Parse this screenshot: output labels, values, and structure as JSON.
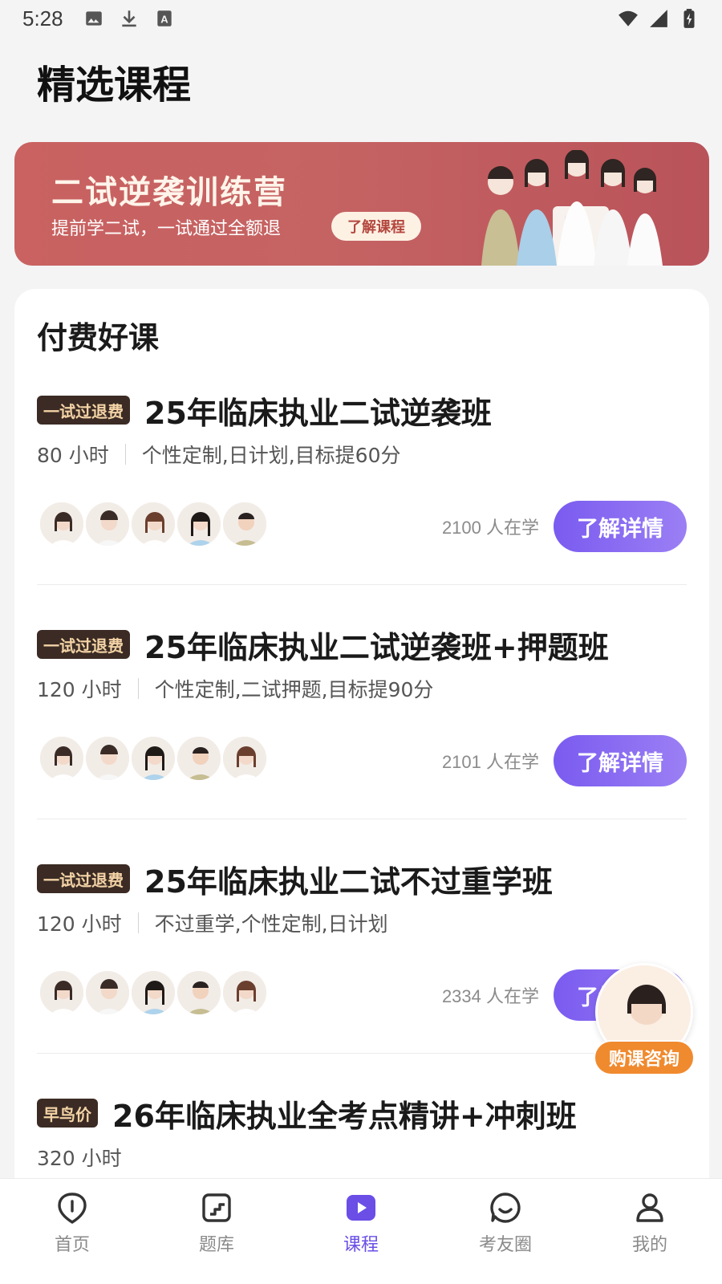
{
  "status_bar": {
    "time": "5:28",
    "left_icons": [
      "image-icon",
      "download-icon",
      "a-icon"
    ],
    "right_icons": [
      "wifi-icon",
      "signal-icon",
      "battery-icon"
    ]
  },
  "page_title": "精选课程",
  "banner": {
    "title": "二试逆袭训练营",
    "subtitle": "提前学二试，一试通过全额退",
    "button_label": "了解课程"
  },
  "section": {
    "title": "付费好课"
  },
  "courses": [
    {
      "badge": "一试过退费",
      "title": "25年临床执业二试逆袭班",
      "hours": "80 小时",
      "features": "个性定制,日计划,目标提60分",
      "learners": "2100 人在学",
      "button_label": "了解详情"
    },
    {
      "badge": "一试过退费",
      "title": "25年临床执业二试逆袭班+押题班",
      "hours": "120 小时",
      "features": "个性定制,二试押题,目标提90分",
      "learners": "2101 人在学",
      "button_label": "了解详情"
    },
    {
      "badge": "一试过退费",
      "title": "25年临床执业二试不过重学班",
      "hours": "120 小时",
      "features": "不过重学,个性定制,日计划",
      "learners": "2334 人在学",
      "button_label": "了解详情"
    },
    {
      "badge": "早鸟价",
      "title": "26年临床执业全考点精讲+冲刺班",
      "hours": "320 小时"
    }
  ],
  "consult": {
    "label": "购课咨询"
  },
  "tabs": [
    {
      "label": "首页",
      "icon": "home-icon"
    },
    {
      "label": "题库",
      "icon": "question-bank-icon"
    },
    {
      "label": "课程",
      "icon": "course-play-icon",
      "active": true
    },
    {
      "label": "考友圈",
      "icon": "community-icon"
    },
    {
      "label": "我的",
      "icon": "profile-icon"
    }
  ],
  "colors": {
    "accent": "#7a5bf0",
    "badge_bg": "#3b2b24",
    "banner": "#c96261",
    "consult": "#f08a2e"
  }
}
